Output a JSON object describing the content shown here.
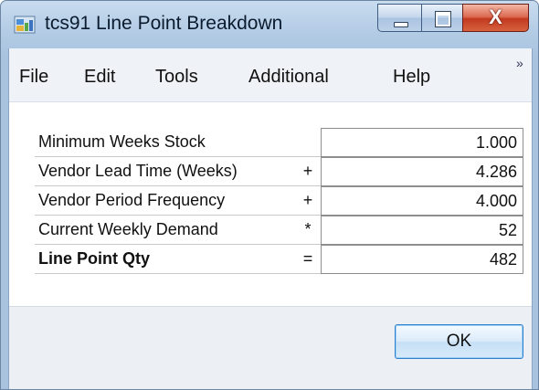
{
  "window": {
    "title": "tcs91 Line Point Breakdown",
    "close_glyph": "X"
  },
  "menu": {
    "items": [
      "File",
      "Edit",
      "Tools",
      "Additional",
      "Help"
    ],
    "overflow": "»"
  },
  "rows": [
    {
      "label": "Minimum Weeks Stock",
      "op": "",
      "value": "1.000"
    },
    {
      "label": "Vendor Lead Time (Weeks)",
      "op": "+",
      "value": "4.286"
    },
    {
      "label": "Vendor Period Frequency",
      "op": "+",
      "value": "4.000"
    },
    {
      "label": "Current Weekly Demand",
      "op": "*",
      "value": "52"
    },
    {
      "label": "Line Point Qty",
      "op": "=",
      "value": "482"
    }
  ],
  "buttons": {
    "ok": "OK"
  },
  "colors": {
    "accent": "#2f7fcf",
    "close": "#c23a20",
    "title_bar": "#b5cde6"
  }
}
